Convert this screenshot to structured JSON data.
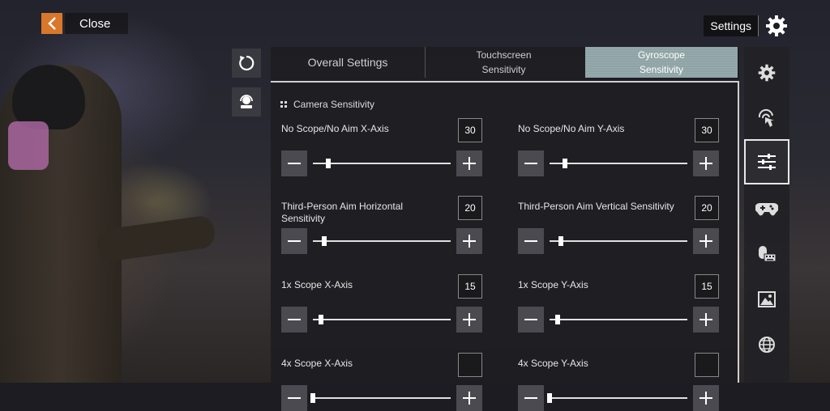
{
  "header": {
    "close_label": "Close",
    "settings_label": "Settings"
  },
  "tabs": [
    {
      "line1": "Overall Settings",
      "line2": ""
    },
    {
      "line1": "Touchscreen",
      "line2": "Sensitivity"
    },
    {
      "line1": "Gyroscope",
      "line2": "Sensitivity",
      "active": true
    }
  ],
  "section": {
    "title": "Camera Sensitivity"
  },
  "settings": [
    {
      "label": "No Scope/No Aim X-Axis",
      "value": "30",
      "fraction": 0.11
    },
    {
      "label": "No Scope/No Aim Y-Axis",
      "value": "30",
      "fraction": 0.11
    },
    {
      "label": "Third-Person Aim Horizontal Sensitivity",
      "value": "20",
      "fraction": 0.08
    },
    {
      "label": "Third-Person Aim Vertical Sensitivity",
      "value": "20",
      "fraction": 0.08
    },
    {
      "label": "1x Scope X-Axis",
      "value": "15",
      "fraction": 0.06
    },
    {
      "label": "1x Scope Y-Axis",
      "value": "15",
      "fraction": 0.06
    },
    {
      "label": "4x Scope X-Axis",
      "value": "",
      "fraction": 0.0
    },
    {
      "label": "4x Scope Y-Axis",
      "value": "",
      "fraction": 0.0
    }
  ],
  "sidebar": {
    "items": [
      {
        "icon": "gear-icon"
      },
      {
        "icon": "touch-icon"
      },
      {
        "icon": "sliders-icon",
        "active": true
      },
      {
        "icon": "gamepad-icon"
      },
      {
        "icon": "mouse-keyboard-icon"
      },
      {
        "icon": "image-icon"
      },
      {
        "icon": "globe-icon"
      }
    ]
  },
  "colors": {
    "accent": "#d9782a",
    "active_tab": "#8fa4a6"
  }
}
